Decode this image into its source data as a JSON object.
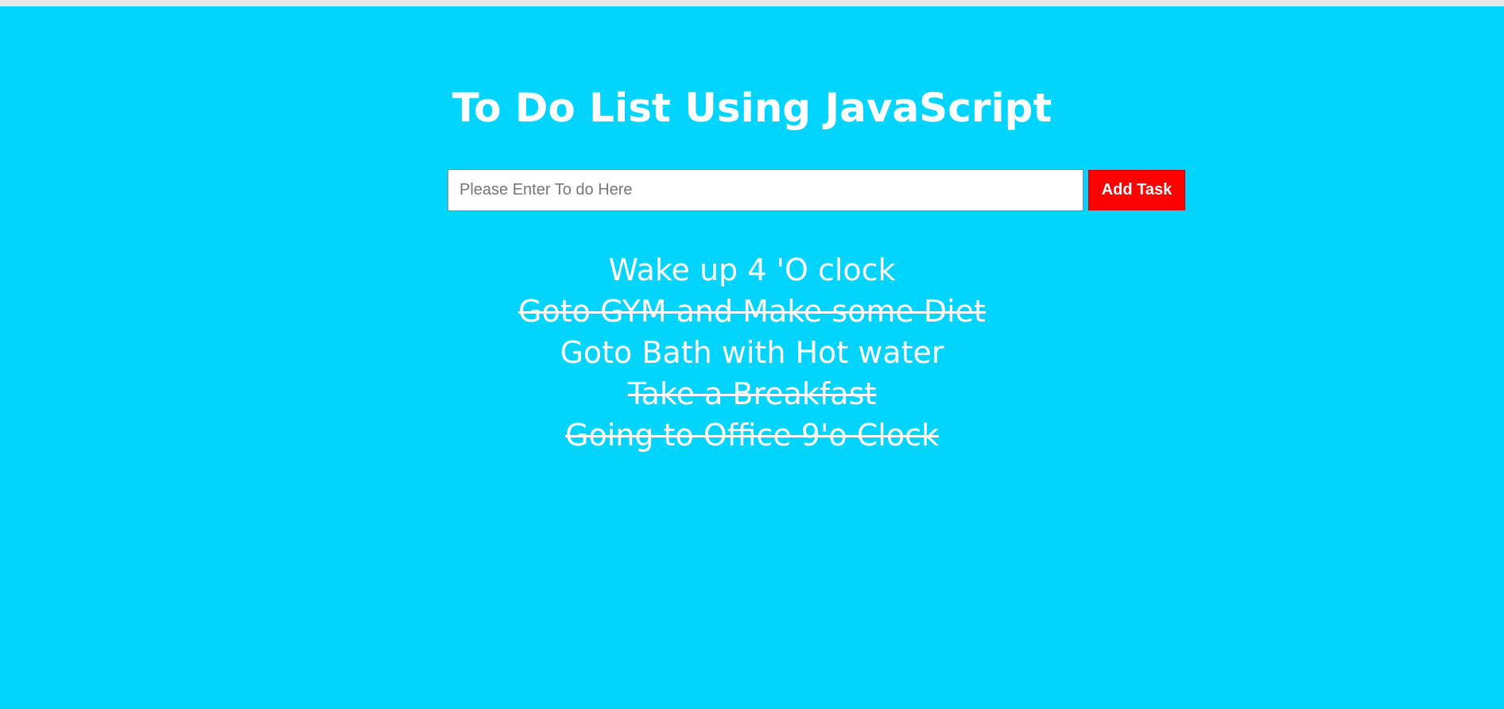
{
  "page": {
    "title": "To Do List Using JavaScript",
    "background_color": "#00d4ff"
  },
  "form": {
    "input_value": "",
    "input_placeholder": "Please Enter To do Here",
    "add_button_label": "Add Task",
    "add_button_color": "#ff0000"
  },
  "tasks": [
    {
      "text": "Wake up 4 'O clock",
      "done": false
    },
    {
      "text": "Goto GYM and Make some Diet",
      "done": true
    },
    {
      "text": "Goto Bath with Hot water",
      "done": false
    },
    {
      "text": "Take a Breakfast",
      "done": true
    },
    {
      "text": "Going to Office 9'o Clock",
      "done": true
    }
  ]
}
